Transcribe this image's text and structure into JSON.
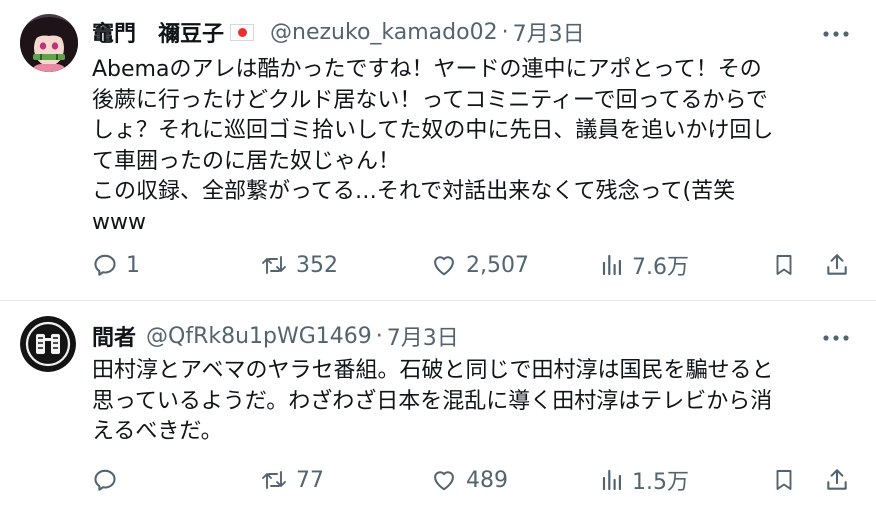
{
  "tweets": [
    {
      "name": "竈門　禰豆子",
      "handle": "@nezuko_kamado02",
      "separator": "·",
      "date": "7月3日",
      "lines": [
        "Abemaのアレは酷かったですね！ヤードの連中にアポとって！その",
        "後蕨に行ったけどクルド居ない！ってコミニティーで回ってるからで",
        "しょ？それに巡回ゴミ拾いしてた奴の中に先日、議員を追いかけ回し",
        "て車囲ったのに居た奴じゃん！",
        "この収録、全部繋がってる…それで対話出来なくて残念って(苦笑",
        "www"
      ],
      "replies": "1",
      "retweets": "352",
      "likes": "2,507",
      "views": "7.6万"
    },
    {
      "name": "間者",
      "handle": "@QfRk8u1pWG1469",
      "separator": "·",
      "date": "7月3日",
      "lines": [
        "田村淳とアベマのヤラセ番組。石破と同じで田村淳は国民を騙せると",
        "思っているようだ。わざわざ日本を混乱に導く田村淳はテレビから消",
        "えるべきだ。"
      ],
      "replies": "",
      "retweets": "77",
      "likes": "489",
      "views": "1.5万"
    }
  ],
  "colors": {
    "text": "#0f1419",
    "secondary": "#536471",
    "flag_red": "#e8302f",
    "divider": "#e6e8ea"
  },
  "icons": [
    "reply-icon",
    "retweet-icon",
    "like-icon",
    "views-icon",
    "bookmark-icon",
    "share-icon",
    "more-icon"
  ]
}
